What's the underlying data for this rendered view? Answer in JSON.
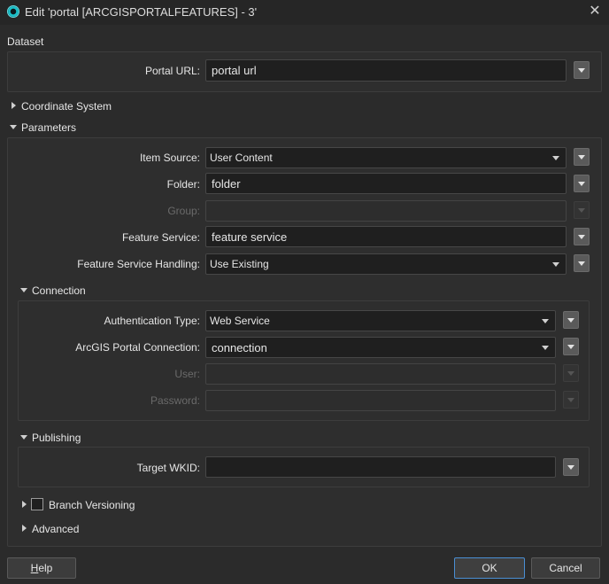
{
  "window": {
    "title": "Edit 'portal [ARCGISPORTALFEATURES] - 3'"
  },
  "dataset": {
    "label": "Dataset",
    "portal_url_label": "Portal URL:",
    "portal_url_value": "portal url"
  },
  "sections": {
    "coordinate_system": "Coordinate System",
    "parameters": "Parameters",
    "connection": "Connection",
    "publishing": "Publishing",
    "branch_versioning": "Branch Versioning",
    "advanced": "Advanced"
  },
  "parameters": {
    "item_source_label": "Item Source:",
    "item_source_value": "User Content",
    "folder_label": "Folder:",
    "folder_value": "folder",
    "group_label": "Group:",
    "group_value": "",
    "feature_service_label": "Feature Service:",
    "feature_service_value": "feature service",
    "handling_label": "Feature Service Handling:",
    "handling_value": "Use Existing"
  },
  "connection": {
    "auth_type_label": "Authentication Type:",
    "auth_type_value": "Web Service",
    "portal_connection_label": "ArcGIS Portal Connection:",
    "portal_connection_value": "connection",
    "user_label": "User:",
    "user_value": "",
    "password_label": "Password:",
    "password_value": ""
  },
  "publishing": {
    "target_wkid_label": "Target WKID:",
    "target_wkid_value": ""
  },
  "branch_versioning_checked": false,
  "buttons": {
    "help_prefix": "H",
    "help_rest": "elp",
    "ok": "OK",
    "cancel": "Cancel"
  }
}
